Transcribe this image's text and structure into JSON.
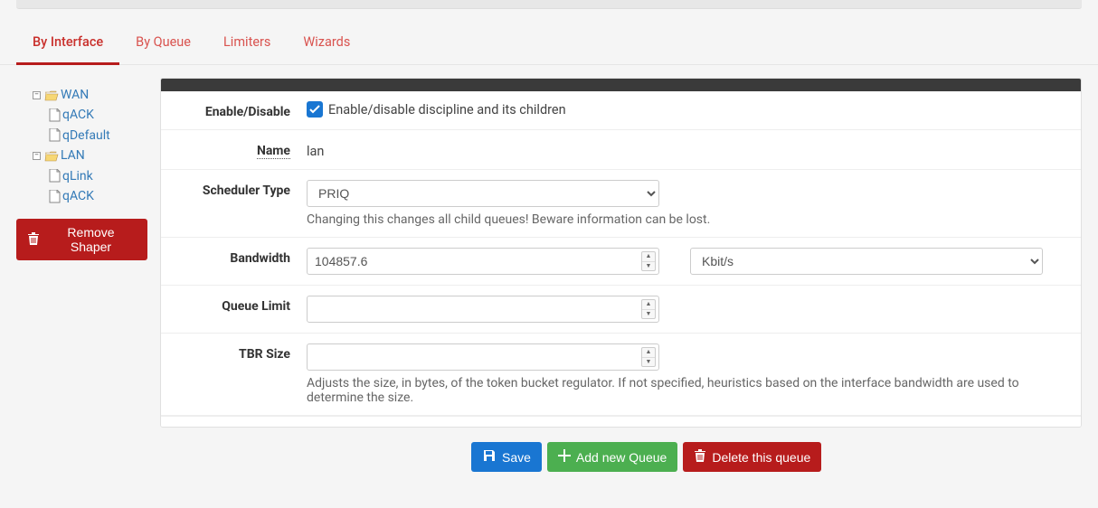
{
  "tabs": {
    "by_interface": "By Interface",
    "by_queue": "By Queue",
    "limiters": "Limiters",
    "wizards": "Wizards"
  },
  "tree": {
    "wan": {
      "label": "WAN"
    },
    "wan_children": {
      "qack": "qACK",
      "qdefault": "qDefault"
    },
    "lan": {
      "label": "LAN"
    },
    "lan_children": {
      "qlink": "qLink",
      "qack": "qACK"
    }
  },
  "remove_shaper_label": "Remove Shaper",
  "form": {
    "enable_label": "Enable/Disable",
    "enable_text": "Enable/disable discipline and its children",
    "name_label": "Name",
    "name_value": "lan",
    "scheduler_label": "Scheduler Type",
    "scheduler_value": "PRIQ",
    "scheduler_help": "Changing this changes all child queues! Beware information can be lost.",
    "bandwidth_label": "Bandwidth",
    "bandwidth_value": "104857.6",
    "bandwidth_unit": "Kbit/s",
    "queue_limit_label": "Queue Limit",
    "queue_limit_value": "",
    "tbr_label": "TBR Size",
    "tbr_value": "",
    "tbr_help": "Adjusts the size, in bytes, of the token bucket regulator. If not specified, heuristics based on the interface bandwidth are used to determine the size."
  },
  "actions": {
    "save": "Save",
    "add_queue": "Add new Queue",
    "delete_queue": "Delete this queue"
  }
}
